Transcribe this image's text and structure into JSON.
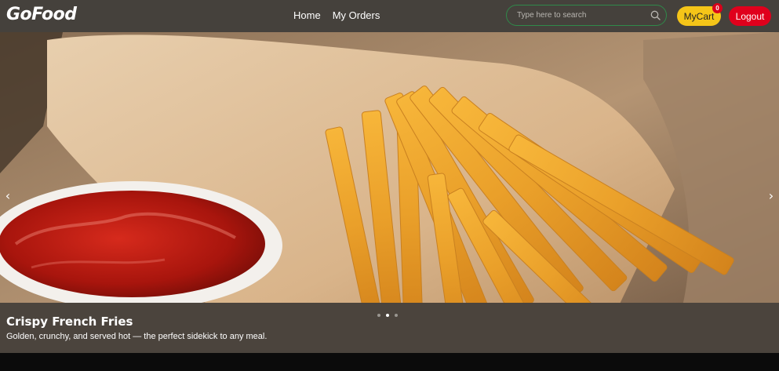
{
  "navbar": {
    "brand": "GoFood",
    "links": [
      "Home",
      "My Orders"
    ],
    "search_placeholder": "Type here to search",
    "cart_label": "MyCart",
    "cart_count": "0",
    "logout_label": "Logout"
  },
  "carousel": {
    "caption_title": "Crispy French Fries",
    "caption_text": "Golden, crunchy, and served hot — the perfect sidekick to any meal.",
    "slide_count": 3,
    "active_index": 1,
    "prev_label": "‹",
    "next_label": "›"
  },
  "colors": {
    "navbar_bg": "#45413c",
    "cart_button": "#f5c518",
    "logout_button": "#e0001c",
    "search_border": "#2f8a4a"
  }
}
